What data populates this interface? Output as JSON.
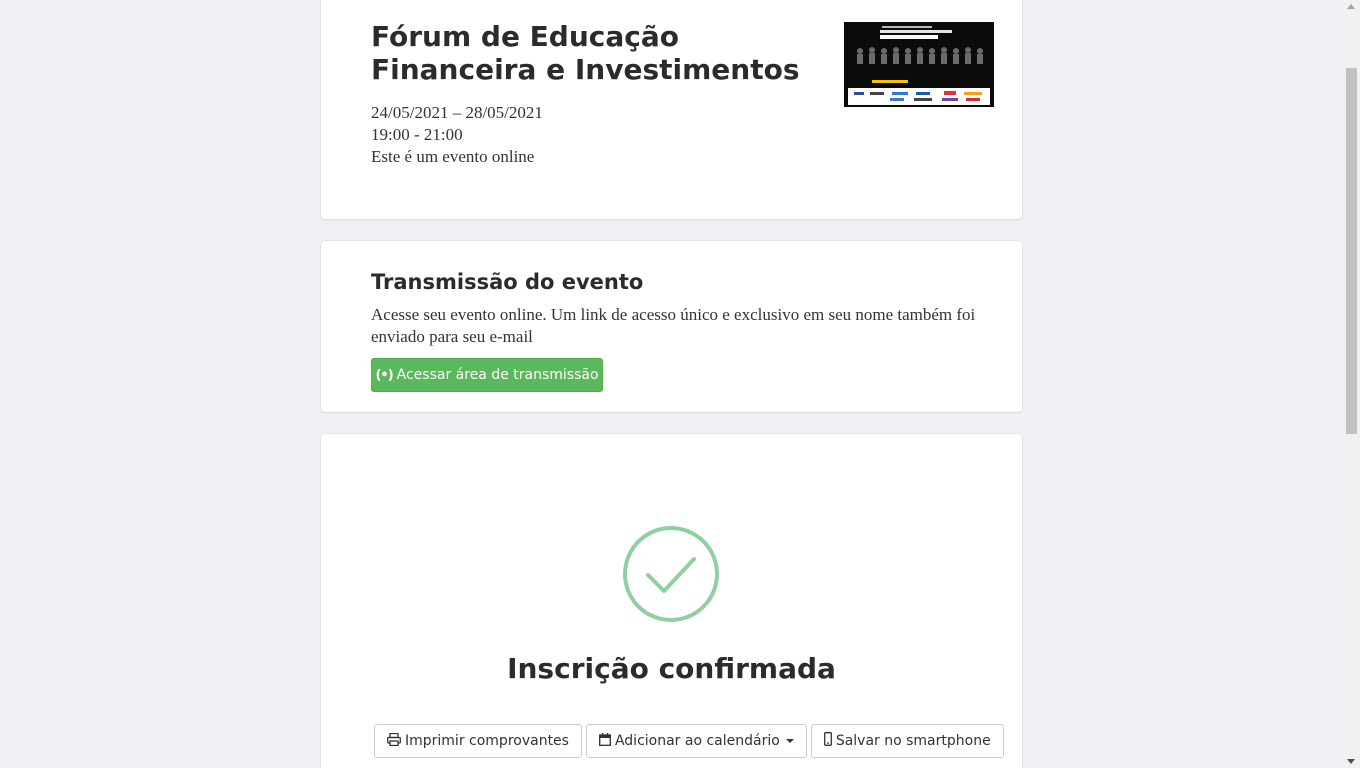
{
  "event": {
    "title": "Fórum de Educação Financeira e Investimentos",
    "date_range": "24/05/2021 – 28/05/2021",
    "time": "19:00 - 21:00",
    "location": "Este é um evento online"
  },
  "transmission": {
    "title": "Transmissão do evento",
    "description": "Acesse seu evento online. Um link de acesso único e exclusivo em seu nome também foi enviado para seu e-mail",
    "button_icon": "(•)",
    "button_label": "Acessar área de transmissão"
  },
  "confirmation": {
    "title": "Inscrição confirmada",
    "print_label": "Imprimir comprovantes",
    "calendar_label": "Adicionar ao calendário",
    "smartphone_label": "Salvar no smartphone"
  },
  "colors": {
    "success": "#5cb85c",
    "check": "#8fd0a0",
    "background": "#eff0f3"
  }
}
